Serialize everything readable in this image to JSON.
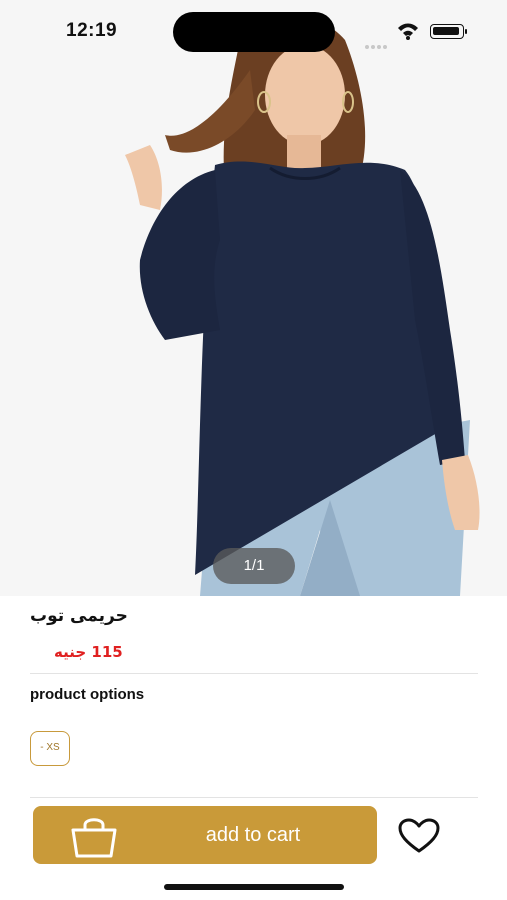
{
  "status_bar": {
    "time": "12:19"
  },
  "gallery": {
    "counter": "1/1"
  },
  "product": {
    "title": "حريمى توب",
    "price": "115 جنيه"
  },
  "options": {
    "label": "product options",
    "sizes": [
      "- XS"
    ]
  },
  "actions": {
    "add_to_cart": "add to cart"
  },
  "icons": {
    "cart": "shopping-bag-icon",
    "favorite": "heart-outline-icon"
  },
  "colors": {
    "accent": "#c99a39",
    "price": "#e02020",
    "chip_border": "#c89a3c"
  }
}
